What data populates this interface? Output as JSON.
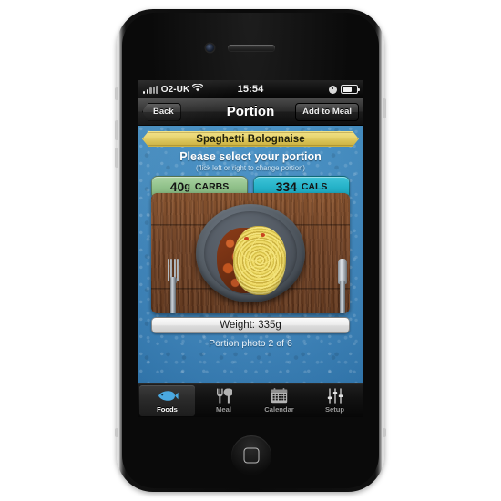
{
  "device": {
    "name": "smartphone",
    "camera_icon": "front-camera-icon",
    "earpiece_icon": "earpiece-speaker-icon",
    "home_button_icon": "home-button-icon"
  },
  "status_bar": {
    "signal_icon": "signal-bars-icon",
    "carrier": "O2-UK",
    "wifi_icon": "wifi-icon",
    "time": "15:54",
    "alarm_icon": "alarm-clock-icon",
    "battery_icon": "battery-icon"
  },
  "nav_bar": {
    "back_label": "Back",
    "title": "Portion",
    "add_label": "Add to Meal"
  },
  "content": {
    "food_name": "Spaghetti Bolognaise",
    "prompt": "Please select your portion",
    "prompt_sub": "(flick left or right to change portion)",
    "badges": [
      {
        "value": "40",
        "unit": "g",
        "label": "CARBS",
        "color": "#8fc089"
      },
      {
        "value": "334",
        "unit": "",
        "label": "CALS",
        "color": "#25b2c8"
      }
    ],
    "photo": {
      "name": "food-photo",
      "alt": "Plate of spaghetti bolognaise with fork and knife on a wooden table"
    },
    "weight": "Weight: 335g",
    "portion_count": "Portion photo 2 of 6",
    "background_color": "#3e8cc6",
    "banner_color": "#e8d571"
  },
  "tab_bar": {
    "tabs": [
      {
        "label": "Foods",
        "icon": "fish-icon",
        "selected": true
      },
      {
        "label": "Meal",
        "icon": "fork-knife-icon",
        "selected": false
      },
      {
        "label": "Calendar",
        "icon": "calendar-icon",
        "selected": false
      },
      {
        "label": "Setup",
        "icon": "sliders-icon",
        "selected": false
      }
    ],
    "selected_color": "#4aa8e0"
  }
}
